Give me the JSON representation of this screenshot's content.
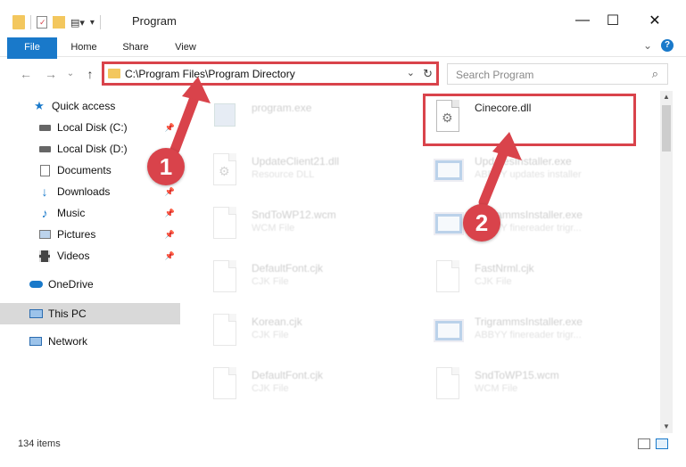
{
  "window": {
    "title": "Program",
    "minimize_glyph": "—",
    "maximize_glyph": "☐",
    "close_glyph": "✕"
  },
  "ribbon": {
    "tabs": [
      {
        "label": "File"
      },
      {
        "label": "Home"
      },
      {
        "label": "Share"
      },
      {
        "label": "View"
      }
    ],
    "expand_glyph": "⌄",
    "help_glyph": "?"
  },
  "navigation": {
    "back_glyph": "←",
    "forward_glyph": "→",
    "recent_glyph": "⌄",
    "up_glyph": "↑"
  },
  "address": {
    "path": "C:\\Program Files\\Program Directory",
    "dropdown_glyph": "⌄",
    "refresh_glyph": "↻"
  },
  "search": {
    "placeholder": "Search Program",
    "icon_glyph": "⌕"
  },
  "sidebar": {
    "items": [
      {
        "label": "Quick access",
        "icon": "star-icon",
        "pinned": false
      },
      {
        "label": "Local Disk (C:)",
        "icon": "drive-icon",
        "pinned": true
      },
      {
        "label": "Local Disk (D:)",
        "icon": "drive-icon",
        "pinned": false
      },
      {
        "label": "Documents",
        "icon": "documents-icon",
        "pinned": true
      },
      {
        "label": "Downloads",
        "icon": "download-icon",
        "pinned": true
      },
      {
        "label": "Music",
        "icon": "music-icon",
        "pinned": true
      },
      {
        "label": "Pictures",
        "icon": "pictures-icon",
        "pinned": true
      },
      {
        "label": "Videos",
        "icon": "videos-icon",
        "pinned": true
      },
      {
        "label": "OneDrive",
        "icon": "cloud-icon",
        "pinned": false
      },
      {
        "label": "This PC",
        "icon": "computer-icon",
        "pinned": false,
        "selected": true
      },
      {
        "label": "Network",
        "icon": "network-icon",
        "pinned": false
      }
    ],
    "pin_glyph": "📌"
  },
  "files": [
    {
      "name": "program.exe",
      "type": "",
      "icon": "setup-icon",
      "highlighted": false
    },
    {
      "name": "Cinecore.dll",
      "type": "",
      "icon": "dll-gear-icon",
      "highlighted": true
    },
    {
      "name": "UpdateClient21.dll",
      "type": "Resource DLL",
      "icon": "dll-icon",
      "highlighted": false
    },
    {
      "name": "UpdatesInstaller.exe",
      "type": "ABBYY updates installer",
      "icon": "app-icon",
      "highlighted": false
    },
    {
      "name": "SndToWP12.wcm",
      "type": "WCM File",
      "icon": "file-icon",
      "highlighted": false
    },
    {
      "name": "TrigrammsInstaller.exe",
      "type": "ABBYY finereader trigr...",
      "icon": "app-icon",
      "highlighted": false
    },
    {
      "name": "DefaultFont.cjk",
      "type": "CJK File",
      "icon": "file-icon",
      "highlighted": false
    },
    {
      "name": "FastNrml.cjk",
      "type": "CJK File",
      "icon": "file-icon",
      "highlighted": false
    },
    {
      "name": "Korean.cjk",
      "type": "CJK File",
      "icon": "file-icon",
      "highlighted": false
    },
    {
      "name": "TrigrammsInstaller.exe",
      "type": "ABBYY finereader trigr...",
      "icon": "app-icon",
      "highlighted": false
    },
    {
      "name": "DefaultFont.cjk",
      "type": "CJK File",
      "icon": "file-icon",
      "highlighted": false
    },
    {
      "name": "SndToWP15.wcm",
      "type": "WCM File",
      "icon": "file-icon",
      "highlighted": false
    }
  ],
  "status": {
    "item_count": "134 items"
  },
  "annotations": {
    "step1": "1",
    "step2": "2",
    "color": "#d9434b"
  },
  "colors": {
    "accent": "#1979ca",
    "selected_bg": "#d9d9d9",
    "folder": "#f3c75e"
  }
}
